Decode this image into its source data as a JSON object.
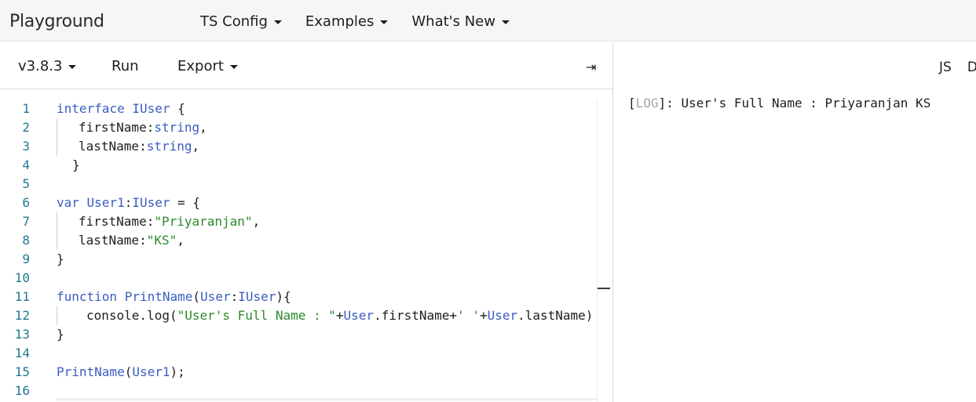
{
  "nav": {
    "brand": "Playground",
    "items": [
      {
        "label": "TS Config"
      },
      {
        "label": "Examples"
      },
      {
        "label": "What's New"
      }
    ]
  },
  "toolbar": {
    "version": "v3.8.3",
    "run": "Run",
    "export": "Export",
    "collapse_icon": "⇥"
  },
  "editor": {
    "line_numbers": [
      "1",
      "2",
      "3",
      "4",
      "5",
      "6",
      "7",
      "8",
      "9",
      "10",
      "11",
      "12",
      "13",
      "14",
      "15",
      "16"
    ],
    "lines": [
      [
        [
          "kw",
          "interface "
        ],
        [
          "ty",
          "IUser"
        ],
        [
          "",
          "{"
        ]
      ],
      [
        [
          "",
          "firstName:"
        ],
        [
          "ty",
          "string"
        ],
        [
          "",
          ","
        ]
      ],
      [
        [
          "",
          "lastName:"
        ],
        [
          "ty",
          "string"
        ],
        [
          "",
          ","
        ]
      ],
      [
        [
          "",
          "}"
        ]
      ],
      [],
      [
        [
          "kw",
          "var "
        ],
        [
          "ident",
          "User1"
        ],
        [
          "",
          ":"
        ],
        [
          "ty",
          "IUser"
        ],
        [
          "",
          " = {"
        ]
      ],
      [
        [
          "",
          "firstName:"
        ],
        [
          "st",
          "\"Priyaranjan\""
        ],
        [
          "",
          ","
        ]
      ],
      [
        [
          "",
          "lastName:"
        ],
        [
          "st",
          "\"KS\""
        ],
        [
          "",
          ","
        ]
      ],
      [
        [
          "",
          "}"
        ]
      ],
      [],
      [
        [
          "kw",
          "function "
        ],
        [
          "ident",
          "PrintName"
        ],
        [
          "",
          "("
        ],
        [
          "ident",
          "User"
        ],
        [
          "",
          ":"
        ],
        [
          "ty",
          "IUser"
        ],
        [
          "",
          "){"
        ]
      ],
      [
        [
          "",
          "console.log("
        ],
        [
          "st",
          "\"User's Full Name : \""
        ],
        [
          "",
          "+"
        ],
        [
          "ident",
          "User"
        ],
        [
          "",
          ".firstName+"
        ],
        [
          "st",
          "' '"
        ],
        [
          "",
          "+"
        ],
        [
          "ident",
          "User"
        ],
        [
          "",
          ".lastName)"
        ]
      ],
      [
        [
          "",
          "}"
        ]
      ],
      [],
      [
        [
          "ident",
          "PrintName"
        ],
        [
          "",
          "("
        ],
        [
          "ident",
          "User1"
        ],
        [
          "",
          ");"
        ]
      ],
      []
    ]
  },
  "output": {
    "tabs": [
      "JS",
      "D"
    ],
    "log_tag": "LOG",
    "log_open": "[",
    "log_close": "]",
    "log_message": ": User's Full Name : Priyaranjan KS"
  }
}
